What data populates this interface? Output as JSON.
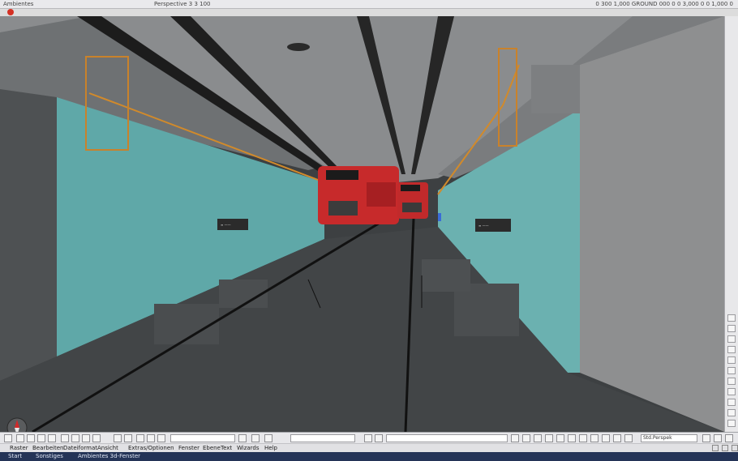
{
  "window": {
    "title_left": "Ambientes",
    "title_center": "Perspective  3  3  100",
    "title_right": "0 300 1,000  GROUND  000 0 0  3,000  0  0  1,000  0"
  },
  "viewport": {
    "sign_left_text": "≡ ——",
    "sign_right_text": "≡ ——",
    "colors": {
      "wall_teal": "#5fa8a8",
      "train_red": "#c72a2b",
      "ceiling": "#8b8d8f",
      "floor": "#3f4244"
    }
  },
  "toolbar": {
    "zoom_field": "",
    "search_field": "",
    "layer_field": "",
    "right_select": "Std.Perspek"
  },
  "menu": {
    "items": [
      "Raster",
      "Bearbeiten",
      "Dateiformat",
      "Ansicht",
      "Extras/Optionen",
      "Fenster",
      "Ebene",
      "Text",
      "Wizards",
      "Help"
    ]
  },
  "status": {
    "left": "Start",
    "center_1": "Sonstiges",
    "center_2": "Ambientes 3d-Fenster"
  },
  "icons": {
    "compass": "compass-icon",
    "stop": "stop-icon"
  }
}
